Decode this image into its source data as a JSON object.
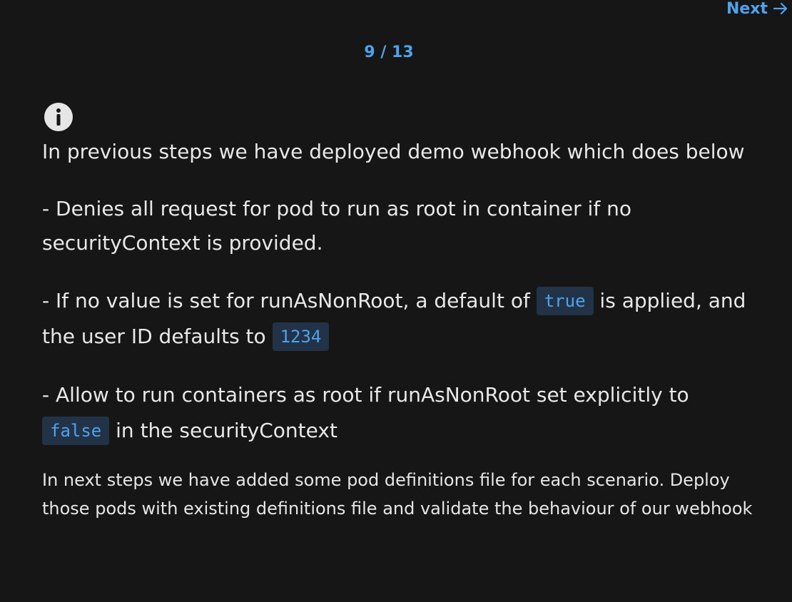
{
  "nav": {
    "next_label": "Next",
    "step_counter": "9 / 13"
  },
  "icons": {
    "info": "info-icon",
    "next_arrow": "arrow-right-icon"
  },
  "colors": {
    "background": "#161616",
    "accent": "#4ea3ec",
    "text": "#e8e8e8",
    "code_background": "#223347"
  },
  "content": {
    "lead": "In previous steps we have deployed demo webhook which does below",
    "point1": "- Denies all request for pod to run as root in container if no securityContext is provided.",
    "point2": {
      "part1": "- If no value is set for runAsNonRoot, a default of",
      "code1": "true",
      "part2": "is applied, and the user ID defaults to",
      "code2": "1234"
    },
    "point3": {
      "part1": "- Allow to run containers as root if runAsNonRoot set explicitly to",
      "code1": "false",
      "part2": "in the securityContext"
    },
    "note": "In next steps we have added some pod definitions file for each scenario. Deploy those pods with existing definitions file and validate the behaviour of our webhook"
  }
}
